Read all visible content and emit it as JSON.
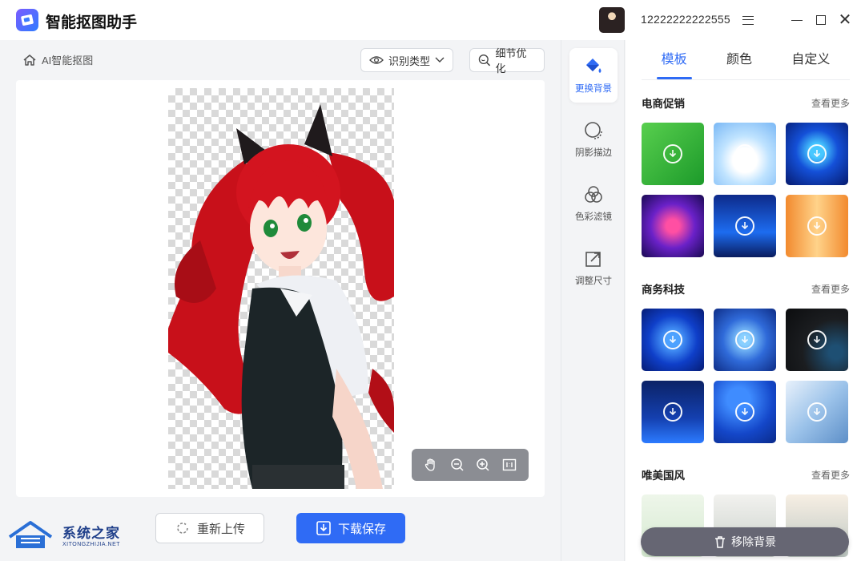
{
  "app": {
    "title": "智能抠图助手",
    "username": "12222222222555"
  },
  "breadcrumb": {
    "label": "AI智能抠图"
  },
  "toolbar": {
    "recognize_label": "识别类型",
    "refine_label": "细节优化"
  },
  "actions": {
    "reupload_label": "重新上传",
    "download_label": "下载保存"
  },
  "watermark": {
    "cn": "系统之家",
    "en": "XITONGZHIJIA.NET"
  },
  "tools": [
    {
      "label": "更换背景",
      "icon": "paint-bucket-icon",
      "active": true
    },
    {
      "label": "阴影描边",
      "icon": "shadow-circle-icon",
      "active": false
    },
    {
      "label": "色彩滤镜",
      "icon": "color-filter-icon",
      "active": false
    },
    {
      "label": "调整尺寸",
      "icon": "resize-icon",
      "active": false
    }
  ],
  "tabs": [
    {
      "label": "模板",
      "active": true
    },
    {
      "label": "颜色",
      "active": false
    },
    {
      "label": "自定义",
      "active": false
    }
  ],
  "sections": [
    {
      "title": "电商促销",
      "more": "查看更多"
    },
    {
      "title": "商务科技",
      "more": "查看更多"
    },
    {
      "title": "唯美国风",
      "more": "查看更多"
    }
  ],
  "remove_bg": {
    "label": "移除背景"
  },
  "colors": {
    "accent": "#2f6bf5",
    "remove_btn": "#666673"
  }
}
